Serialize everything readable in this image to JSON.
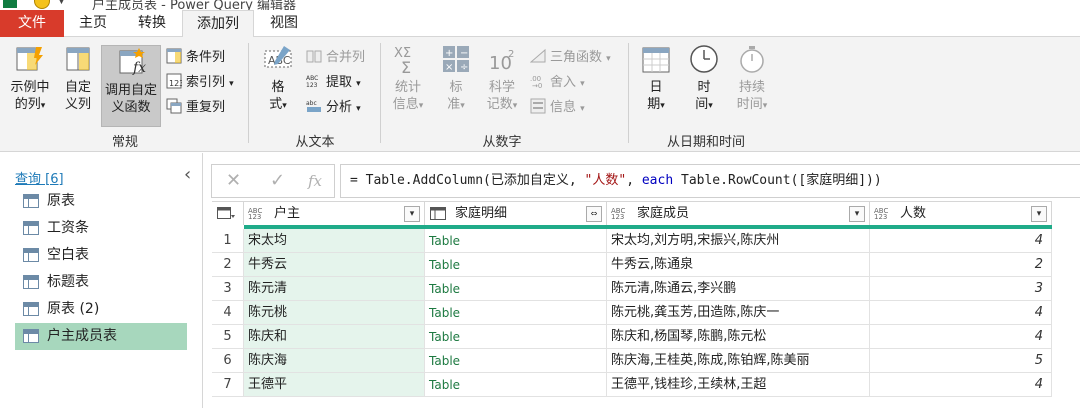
{
  "window": {
    "title": "户主成员表 - Power Query 编辑器"
  },
  "tabs": [
    "文件",
    "主页",
    "转换",
    "添加列",
    "视图"
  ],
  "ribbon": {
    "general": {
      "example_col": "示例中\n的列",
      "custom_col": "自定\n义列",
      "invoke_fn": "调用自定\n义函数",
      "conditional": "条件列",
      "index": "索引列",
      "duplicate": "重复列",
      "label": "常规"
    },
    "text": {
      "format": "格\n式",
      "merge": "合并列",
      "extract": "提取",
      "parse": "分析",
      "label": "从文本"
    },
    "number": {
      "stats": "统计\n信息",
      "standard": "标\n准",
      "scientific": "科学\n记数",
      "trig": "三角函数",
      "round": "舍入",
      "info": "信息",
      "label": "从数字"
    },
    "datetime": {
      "date": "日\n期",
      "time": "时\n间",
      "duration": "持续\n时间",
      "label": "从日期和时间"
    }
  },
  "queries": {
    "header": "查询 [6]",
    "items": [
      "原表",
      "工资条",
      "空白表",
      "标题表",
      "原表 (2)",
      "户主成员表"
    ],
    "selected": 5
  },
  "formula_bar": {
    "prefix": "= Table.AddColumn(已添加自定义, ",
    "str1": "\"人数\"",
    "mid": ", ",
    "kw": "each",
    "rest": " Table.RowCount([家庭明细]))"
  },
  "table": {
    "columns": [
      {
        "name": "户主",
        "type": "ABC\n123"
      },
      {
        "name": "家庭明细",
        "type": "table"
      },
      {
        "name": "家庭成员",
        "type": "ABC\n123"
      },
      {
        "name": "人数",
        "type": "ABC\n123"
      }
    ],
    "rows": [
      {
        "idx": "1",
        "head": "宋太均",
        "detail": "Table",
        "members": "宋太均,刘方明,宋振兴,陈庆州",
        "count": "4"
      },
      {
        "idx": "2",
        "head": "牛秀云",
        "detail": "Table",
        "members": "牛秀云,陈通泉",
        "count": "2"
      },
      {
        "idx": "3",
        "head": "陈元清",
        "detail": "Table",
        "members": "陈元清,陈通云,李兴鹏",
        "count": "3"
      },
      {
        "idx": "4",
        "head": "陈元桃",
        "detail": "Table",
        "members": "陈元桃,龚玉芳,田造陈,陈庆一",
        "count": "4"
      },
      {
        "idx": "5",
        "head": "陈庆和",
        "detail": "Table",
        "members": "陈庆和,杨国琴,陈鹏,陈元松",
        "count": "4"
      },
      {
        "idx": "6",
        "head": "陈庆海",
        "detail": "Table",
        "members": "陈庆海,王桂英,陈成,陈铂辉,陈美丽",
        "count": "5"
      },
      {
        "idx": "7",
        "head": "王德平",
        "detail": "Table",
        "members": "王德平,钱桂珍,王续林,王超",
        "count": "4"
      }
    ]
  },
  "colors": {
    "accent": "#1fab89",
    "file_tab": "#d83b2b",
    "selected_query": "#a7d7bd"
  }
}
